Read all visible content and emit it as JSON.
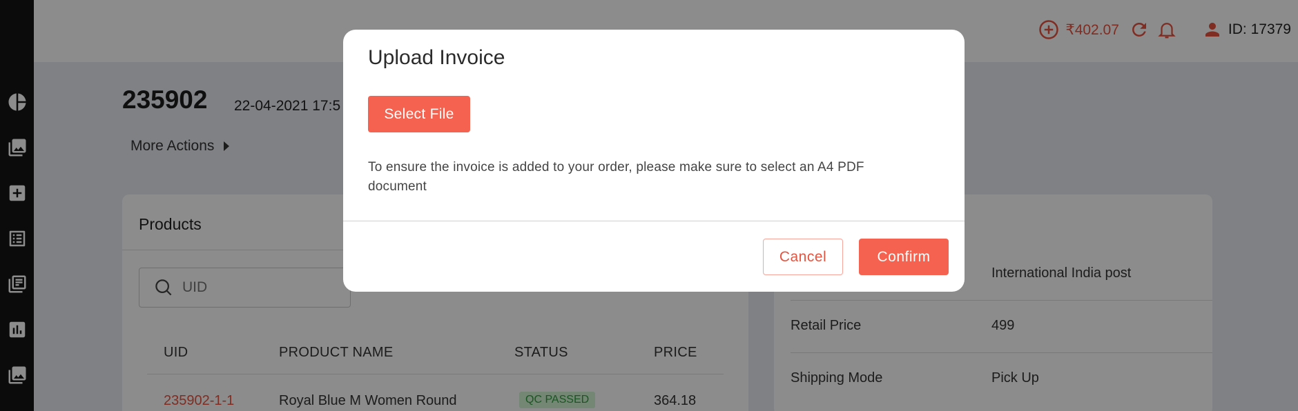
{
  "header": {
    "credit_amount": "₹402.07",
    "user_id_label": "ID: 17379",
    "icons": [
      "add-circle-icon",
      "refresh-icon",
      "bell-icon",
      "user-icon"
    ]
  },
  "sidebar": {
    "icons": [
      "pie-chart-icon",
      "gallery-icon",
      "add-box-icon",
      "list-icon",
      "library-books-icon",
      "bar-chart-icon",
      "gallery-icon"
    ]
  },
  "order": {
    "id": "235902",
    "date": "22-04-2021 17:5",
    "more_actions": "More Actions"
  },
  "products": {
    "title": "Products",
    "search_placeholder": "UID",
    "columns": [
      "UID",
      "PRODUCT NAME",
      "STATUS",
      "PRICE"
    ],
    "rows": [
      {
        "uid": "235902-1-1",
        "name": "Royal Blue M Women Round",
        "status": "QC PASSED",
        "price": "364.18"
      }
    ]
  },
  "details": {
    "rows": [
      {
        "label": "",
        "value": "International India post"
      },
      {
        "label": "Retail Price",
        "value": "499"
      },
      {
        "label": "Shipping Mode",
        "value": "Pick Up"
      }
    ]
  },
  "modal": {
    "title": "Upload Invoice",
    "select_file": "Select File",
    "message": "To ensure the invoice is added to your order, please make sure to select an A4 PDF document",
    "cancel": "Cancel",
    "confirm": "Confirm"
  },
  "colors": {
    "accent": "#f5624f",
    "accent_text": "#e8533f",
    "sidebar_bg": "#141414",
    "status_green": "#2f9c3c"
  }
}
